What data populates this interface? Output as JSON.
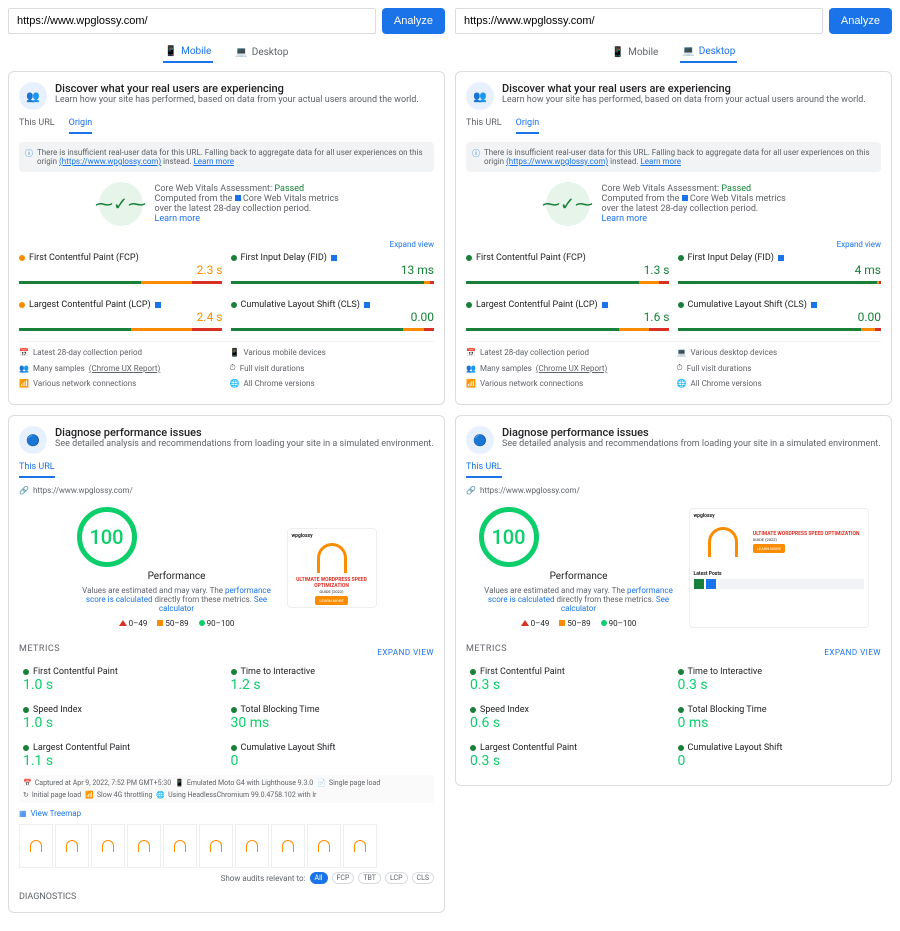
{
  "url": "https://www.wpglossy.com/",
  "analyze_label": "Analyze",
  "devices": {
    "mobile": "Mobile",
    "desktop": "Desktop"
  },
  "discover": {
    "title": "Discover what your real users are experiencing",
    "subtitle": "Learn how your site has performed, based on data from your actual users around the world."
  },
  "subtabs": {
    "this_url": "This URL",
    "origin": "Origin"
  },
  "notice": {
    "prefix": "There is insufficient real-user data for this URL. Falling back to aggregate data for all user experiences on this origin",
    "origin_link": "(https://www.wpglossy.com)",
    "instead": " instead. ",
    "learn": "Learn more"
  },
  "cwv": {
    "label": "Core Web Vitals Assessment: ",
    "status": "Passed",
    "sub1": "Computed from the ",
    "sub1b": "Core Web Vitals",
    "sub1c": " metrics over the latest 28-day collection period.",
    "learn": "Learn more"
  },
  "expand": "Expand view",
  "mobile_field": {
    "fcp": {
      "name": "First Contentful Paint (FCP)",
      "value": "2.3 s",
      "status": "o",
      "dist": [
        60,
        25,
        15
      ]
    },
    "fid": {
      "name": "First Input Delay (FID)",
      "value": "13 ms",
      "status": "g",
      "dist": [
        95,
        3,
        2
      ],
      "cwv": true
    },
    "lcp": {
      "name": "Largest Contentful Paint (LCP)",
      "value": "2.4 s",
      "status": "o",
      "dist": [
        55,
        30,
        15
      ],
      "cwv": true
    },
    "cls": {
      "name": "Cumulative Layout Shift (CLS)",
      "value": "0.00",
      "status": "g",
      "dist": [
        85,
        10,
        5
      ],
      "cwv": true
    }
  },
  "desktop_field": {
    "fcp": {
      "name": "First Contentful Paint (FCP)",
      "value": "1.3 s",
      "status": "g",
      "dist": [
        85,
        10,
        5
      ]
    },
    "fid": {
      "name": "First Input Delay (FID)",
      "value": "4 ms",
      "status": "g",
      "dist": [
        98,
        1,
        1
      ],
      "cwv": true
    },
    "lcp": {
      "name": "Largest Contentful Paint (LCP)",
      "value": "1.6 s",
      "status": "g",
      "dist": [
        75,
        15,
        10
      ],
      "cwv": true
    },
    "cls": {
      "name": "Cumulative Layout Shift (CLS)",
      "value": "0.00",
      "status": "g",
      "dist": [
        90,
        7,
        3
      ],
      "cwv": true
    }
  },
  "detail_rows_m": {
    "period": "Latest 28-day collection period",
    "devices": "Various mobile devices",
    "samples": "Many samples",
    "samples_link": "(Chrome UX Report)",
    "visit": "Full visit durations",
    "network": "Various network connections",
    "chrome": "All Chrome versions"
  },
  "detail_rows_d": {
    "period": "Latest 28-day collection period",
    "devices": "Various desktop devices",
    "samples": "Many samples",
    "samples_link": "(Chrome UX Report)",
    "visit": "Full visit durations",
    "network": "Various network connections",
    "chrome": "All Chrome versions"
  },
  "diagnose": {
    "title": "Diagnose performance issues",
    "subtitle": "See detailed analysis and recommendations from loading your site in a simulated environment."
  },
  "score": {
    "value": "100",
    "label": "Performance",
    "note1": "Values are estimated and may vary. The ",
    "note_link1": "performance score is calculated",
    "note2": " directly from these metrics. ",
    "note_link2": "See calculator"
  },
  "legend": {
    "a": "0–49",
    "b": "50–89",
    "c": "90–100"
  },
  "shot": {
    "brand": "wpglossy",
    "headline": "ULTIMATE WORDPRESS SPEED OPTIMIZATION",
    "guide": "GUIDE (2022)",
    "cta": "LEARN MORE",
    "latest": "Latest Posts"
  },
  "metrics_h": "METRICS",
  "mobile_lab": {
    "fcp": {
      "name": "First Contentful Paint",
      "value": "1.0 s",
      "status": "g"
    },
    "tti": {
      "name": "Time to Interactive",
      "value": "1.2 s",
      "status": "g"
    },
    "si": {
      "name": "Speed Index",
      "value": "1.0 s",
      "status": "g"
    },
    "tbt": {
      "name": "Total Blocking Time",
      "value": "30 ms",
      "status": "g"
    },
    "lcp": {
      "name": "Largest Contentful Paint",
      "value": "1.1 s",
      "status": "g"
    },
    "cls": {
      "name": "Cumulative Layout Shift",
      "value": "0",
      "status": "g"
    }
  },
  "desktop_lab": {
    "fcp": {
      "name": "First Contentful Paint",
      "value": "0.3 s",
      "status": "g"
    },
    "tti": {
      "name": "Time to Interactive",
      "value": "0.3 s",
      "status": "g"
    },
    "si": {
      "name": "Speed Index",
      "value": "0.6 s",
      "status": "g"
    },
    "tbt": {
      "name": "Total Blocking Time",
      "value": "0 ms",
      "status": "g"
    },
    "lcp": {
      "name": "Largest Contentful Paint",
      "value": "0.3 s",
      "status": "g"
    },
    "cls": {
      "name": "Cumulative Layout Shift",
      "value": "0",
      "status": "g"
    }
  },
  "capture": {
    "time": "Captured at Apr 9, 2022, 7:52 PM GMT+5:30",
    "device": "Emulated Moto G4 with Lighthouse 9.3.0",
    "page": "Single page load",
    "load": "Initial page load",
    "throttle": "Slow 4G throttling",
    "headless": "Using HeadlessChromium 99.0.4758.102 with lr"
  },
  "treemap": "View Treemap",
  "audits": {
    "label": "Show audits relevant to:",
    "all": "All",
    "fcp": "FCP",
    "tbt": "TBT",
    "lcp": "LCP",
    "cls": "CLS"
  },
  "diagnostics": "DIAGNOSTICS"
}
